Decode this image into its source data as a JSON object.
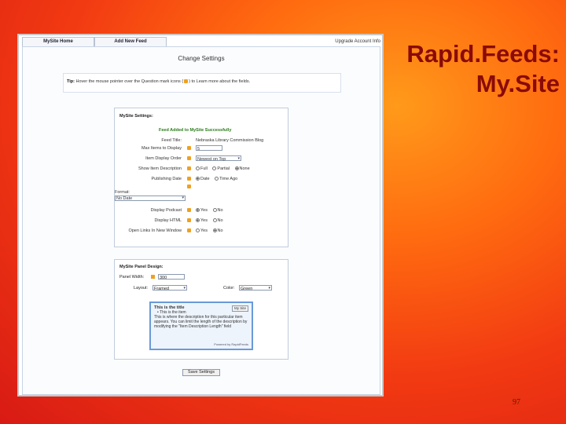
{
  "slide": {
    "title": "Rapid.Feeds: My.Site",
    "page_number": "97"
  },
  "tabs": [
    {
      "label": "MySite Home"
    },
    {
      "label": "Add New Feed"
    }
  ],
  "top_link": "Upgrade Account Info",
  "page_heading": "Change Settings",
  "tip": {
    "label": "Tip:",
    "text_before": "Hover the mouse pointer over the Question mark icons (",
    "text_after": ") to Learn more about the fields."
  },
  "settings": {
    "title": "MySite Settings:",
    "success": "Feed Added to MySite Successfully",
    "feed_title_label": "Feed Title:",
    "feed_title_value": "Nebraska Library Commission Blog",
    "max_items_label": "Max Items to Display",
    "max_items_value": "5",
    "display_order_label": "Item Display Order",
    "display_order_value": "Newest on Top",
    "show_desc_label": "Show Item Description",
    "show_desc_options": [
      "Full",
      "Partial",
      "None"
    ],
    "publishing_label": "Publishing Date",
    "publishing_options": [
      "Date",
      "Time Ago"
    ],
    "format_label": "Format:",
    "format_value": "No Date",
    "display_podcast_label": "Display Podcast",
    "display_html_label": "Display HTML",
    "open_links_label": "Open Links In New Window",
    "yes": "Yes",
    "no": "No"
  },
  "design": {
    "title": "MySite Panel Design:",
    "panel_width_label": "Panel Width:",
    "panel_width_value": "300",
    "layout_label": "Layout:",
    "layout_value": "Framed",
    "colors_label": "Color:",
    "colors_value": "Green",
    "preview": {
      "title": "This is the title",
      "button": "My Site",
      "item": "This is the item",
      "description": "This is where the description for this particular item appears. You can limit the length of the description by modifying the \"Item Description Length\" field",
      "footer": "Powered by RapidFeeds"
    }
  },
  "save_label": "Save Settings"
}
